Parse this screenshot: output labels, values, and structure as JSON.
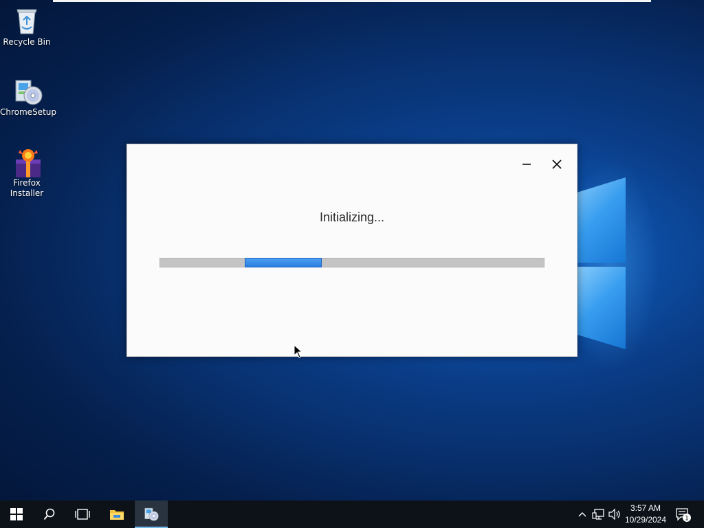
{
  "desktop": {
    "icons": [
      {
        "label": "Recycle Bin",
        "icon": "recycle-bin-icon"
      },
      {
        "label": "ChromeSetup",
        "icon": "installer-disc-icon"
      },
      {
        "label_line1": "Firefox",
        "label_line2": "Installer",
        "icon": "firefox-installer-icon"
      }
    ]
  },
  "dialog": {
    "status_text": "Initializing...",
    "progress": {
      "indeterminate": true,
      "fill_start_fraction": 0.22,
      "fill_end_fraction": 0.42
    },
    "minimize_icon": "minimize-icon",
    "close_icon": "close-icon"
  },
  "taskbar": {
    "start_icon": "windows-start-icon",
    "search_icon": "search-icon",
    "task_view_icon": "task-view-icon",
    "explorer_icon": "file-explorer-icon",
    "active_app_icon": "installer-disc-icon",
    "tray": {
      "chevron_icon": "chevron-up-icon",
      "network_icon": "network-icon",
      "volume_icon": "volume-icon",
      "time": "3:57 AM",
      "date": "10/29/2024",
      "notification_count": "1"
    }
  },
  "colors": {
    "accent": "#2a7fe0",
    "taskbar": "#0d1219",
    "dialog_bg": "#fbfbfb"
  }
}
